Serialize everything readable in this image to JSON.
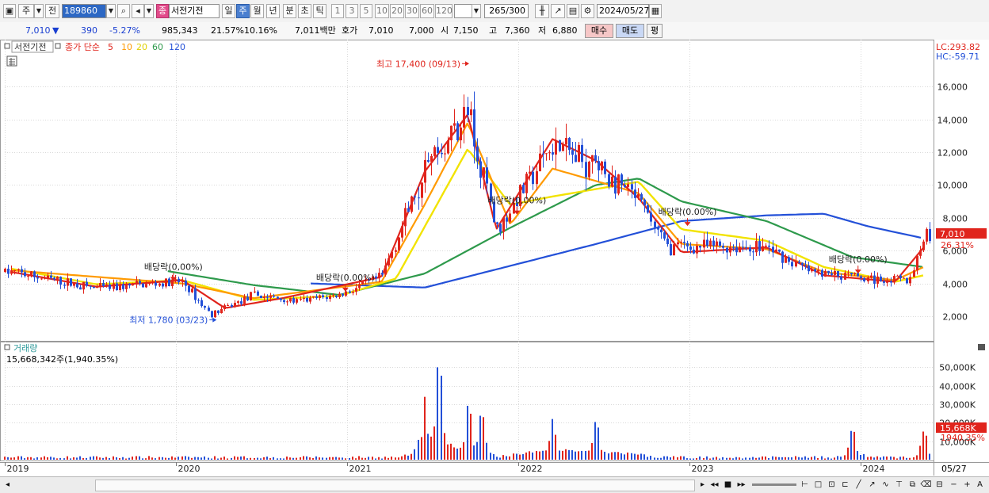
{
  "toolbar": {
    "market": "주",
    "prev": "전",
    "code": "189860",
    "name": "서전기전",
    "badge": "종",
    "periods": [
      "일",
      "주",
      "월",
      "년",
      "분",
      "초",
      "틱"
    ],
    "selected_period": "주",
    "intervals": [
      "1",
      "3",
      "5",
      "10",
      "20",
      "30",
      "60",
      "120"
    ],
    "count": "265",
    "count_max": "/300",
    "date": "2024/05/27"
  },
  "info": {
    "price": "7,010",
    "arrow": "▼",
    "change": "390",
    "change_pct": "-5.27%",
    "volume": "985,343",
    "turnover_pct": "21.57%",
    "foreign_pct": "10.16%",
    "amount": "7,011백만",
    "quote_label": "호가",
    "bid": "7,010",
    "ask": "7,000",
    "open_label": "시",
    "open": "7,150",
    "high_label": "고",
    "high": "7,360",
    "low_label": "저",
    "low": "6,880",
    "buy": "매수",
    "sell": "매도",
    "eval": "평"
  },
  "legend": {
    "name": "서전기전",
    "label": "종가 단순",
    "periods": [
      "5",
      "10",
      "20",
      "60",
      "120"
    ],
    "colors": [
      "#e0241c",
      "#ff9a00",
      "#f2e300",
      "#2e9a4c",
      "#2350d8"
    ]
  },
  "lc": "LC:293.82",
  "hc": "HC:-59.71",
  "price_tag": "7,010",
  "pct_tag": "26.31%",
  "volume_title": "거래량",
  "volume_info": "15,668,342주(1,940.35%)",
  "vol_tag": "15,668K",
  "vol_pct_tag": "1940.35%",
  "date_tag": "05/27",
  "chart_data": {
    "type": "candlestick",
    "x_ticks": [
      "2019",
      "2020",
      "2021",
      "2022",
      "2023",
      "2024"
    ],
    "y_ticks": [
      2000,
      4000,
      6000,
      8000,
      10000,
      12000,
      14000,
      16000
    ],
    "y_tick_labels": [
      "2,000",
      "4,000",
      "6,000",
      "8,000",
      "10,000",
      "12,000",
      "14,000",
      "16,000"
    ],
    "ylim": [
      600,
      17800
    ],
    "vol_ticks": [
      10000,
      20000,
      30000,
      40000,
      50000
    ],
    "vol_tick_labels": [
      "10,000K",
      "20,000K",
      "30,000K",
      "40,000K",
      "50,000K"
    ],
    "vol_ylim": [
      0,
      57000
    ],
    "annotations": [
      {
        "text": "최고 17,400 (09/13)",
        "date": "2021-09-13",
        "value": 17400
      },
      {
        "text": "최저 1,780 (03/23)",
        "date": "2020-03-23",
        "value": 1780
      },
      {
        "text": "배당락(0,00%)",
        "date": "2019-12-27",
        "value": 4250
      },
      {
        "text": "배당락(0.00%)",
        "date": "2020-12-28",
        "value": 3600
      },
      {
        "text": "배당락(0,00%)",
        "date": "2021-12-29",
        "value": 8300
      },
      {
        "text": "배당락(0.00%)",
        "date": "2022-12-28",
        "value": 7600
      },
      {
        "text": "배당락(0.00%)",
        "date": "2023-12-27",
        "value": 4700
      }
    ],
    "price_points": [
      {
        "date": "2019-01",
        "close": 4700
      },
      {
        "date": "2019-04",
        "close": 4200
      },
      {
        "date": "2019-07",
        "close": 3700
      },
      {
        "date": "2019-10",
        "close": 3900
      },
      {
        "date": "2020-01",
        "close": 4100
      },
      {
        "date": "2020-03",
        "close": 2100
      },
      {
        "date": "2020-06",
        "close": 3300
      },
      {
        "date": "2020-09",
        "close": 2900
      },
      {
        "date": "2020-12",
        "close": 3300
      },
      {
        "date": "2021-03",
        "close": 4400
      },
      {
        "date": "2021-06",
        "close": 11000
      },
      {
        "date": "2021-09",
        "close": 14500
      },
      {
        "date": "2021-11",
        "close": 7200
      },
      {
        "date": "2022-03",
        "close": 12500
      },
      {
        "date": "2022-06",
        "close": 11000
      },
      {
        "date": "2022-09",
        "close": 9000
      },
      {
        "date": "2022-11",
        "close": 6200
      },
      {
        "date": "2023-03",
        "close": 6300
      },
      {
        "date": "2023-06",
        "close": 6200
      },
      {
        "date": "2023-09",
        "close": 4700
      },
      {
        "date": "2024-01",
        "close": 4300
      },
      {
        "date": "2024-04",
        "close": 4200
      },
      {
        "date": "2024-05",
        "close": 7010
      }
    ],
    "ma120": [
      {
        "date": "2020-10",
        "value": 4000
      },
      {
        "date": "2021-06",
        "value": 3750
      },
      {
        "date": "2022-01",
        "value": 5300
      },
      {
        "date": "2022-06",
        "value": 6400
      },
      {
        "date": "2022-12",
        "value": 7800
      },
      {
        "date": "2023-06",
        "value": 8150
      },
      {
        "date": "2023-10",
        "value": 8250
      },
      {
        "date": "2024-01",
        "value": 7500
      },
      {
        "date": "2024-05",
        "value": 6750
      }
    ],
    "ma60": [
      {
        "date": "2019-12",
        "value": 4750
      },
      {
        "date": "2020-06",
        "value": 3900
      },
      {
        "date": "2020-12",
        "value": 3300
      },
      {
        "date": "2021-06",
        "value": 4600
      },
      {
        "date": "2021-12",
        "value": 7400
      },
      {
        "date": "2022-06",
        "value": 10000
      },
      {
        "date": "2022-09",
        "value": 10400
      },
      {
        "date": "2022-12",
        "value": 9000
      },
      {
        "date": "2023-06",
        "value": 7800
      },
      {
        "date": "2023-12",
        "value": 5600
      },
      {
        "date": "2024-05",
        "value": 5000
      }
    ],
    "ma20": [
      {
        "date": "2019-01",
        "value": 4900
      },
      {
        "date": "2019-07",
        "value": 3950
      },
      {
        "date": "2020-01",
        "value": 4200
      },
      {
        "date": "2020-06",
        "value": 3000
      },
      {
        "date": "2020-12",
        "value": 3250
      },
      {
        "date": "2021-04",
        "value": 4300
      },
      {
        "date": "2021-09",
        "value": 12200
      },
      {
        "date": "2021-12",
        "value": 8800
      },
      {
        "date": "2022-03",
        "value": 9300
      },
      {
        "date": "2022-09",
        "value": 10200
      },
      {
        "date": "2022-12",
        "value": 7300
      },
      {
        "date": "2023-06",
        "value": 6600
      },
      {
        "date": "2023-10",
        "value": 5000
      },
      {
        "date": "2024-03",
        "value": 4100
      },
      {
        "date": "2024-05",
        "value": 4500
      }
    ],
    "ma10": [
      {
        "date": "2019-01",
        "value": 4800
      },
      {
        "date": "2020-01",
        "value": 4000
      },
      {
        "date": "2020-06",
        "value": 3100
      },
      {
        "date": "2021-03",
        "value": 4100
      },
      {
        "date": "2021-06",
        "value": 8800
      },
      {
        "date": "2021-09",
        "value": 13800
      },
      {
        "date": "2021-12",
        "value": 7600
      },
      {
        "date": "2022-03",
        "value": 11000
      },
      {
        "date": "2022-09",
        "value": 9500
      },
      {
        "date": "2022-12",
        "value": 6400
      },
      {
        "date": "2023-06",
        "value": 6100
      },
      {
        "date": "2023-10",
        "value": 4700
      },
      {
        "date": "2024-03",
        "value": 4200
      },
      {
        "date": "2024-05",
        "value": 5000
      }
    ],
    "ma5": [
      {
        "date": "2019-01",
        "value": 4700
      },
      {
        "date": "2019-07",
        "value": 3800
      },
      {
        "date": "2020-01",
        "value": 4200
      },
      {
        "date": "2020-04",
        "value": 2500
      },
      {
        "date": "2020-08",
        "value": 3100
      },
      {
        "date": "2021-03",
        "value": 4400
      },
      {
        "date": "2021-06",
        "value": 10800
      },
      {
        "date": "2021-09",
        "value": 14300
      },
      {
        "date": "2021-11",
        "value": 7300
      },
      {
        "date": "2022-03",
        "value": 12800
      },
      {
        "date": "2022-06",
        "value": 11500
      },
      {
        "date": "2022-09",
        "value": 9200
      },
      {
        "date": "2022-12",
        "value": 5900
      },
      {
        "date": "2023-06",
        "value": 6200
      },
      {
        "date": "2023-10",
        "value": 4500
      },
      {
        "date": "2024-03",
        "value": 4100
      },
      {
        "date": "2024-05",
        "value": 6200
      }
    ],
    "volume_peaks": [
      {
        "date": "2021-06",
        "value": 34000
      },
      {
        "date": "2021-07",
        "value": 53000
      },
      {
        "date": "2021-09",
        "value": 30000
      },
      {
        "date": "2021-10",
        "value": 26000
      },
      {
        "date": "2022-03",
        "value": 22000
      },
      {
        "date": "2022-06",
        "value": 21000
      },
      {
        "date": "2023-12",
        "value": 17000
      },
      {
        "date": "2024-05",
        "value": 15668
      }
    ]
  }
}
